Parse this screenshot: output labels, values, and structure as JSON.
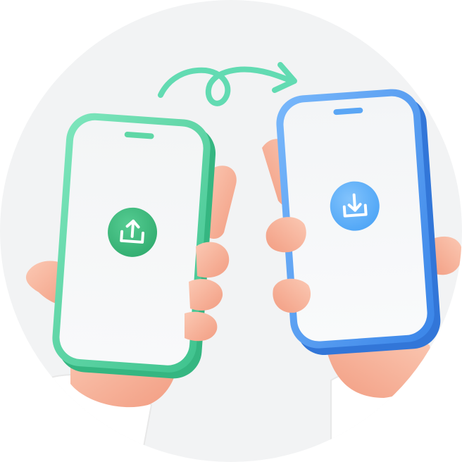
{
  "scene": {
    "description_free": true,
    "background_circle_color": "#f2f3f4",
    "transfer_arrow": {
      "icon": "curly-arrow-icon",
      "color": "#62dbb2"
    },
    "sender_phone": {
      "frame_color": "#5fd7a6",
      "screen_color": "#f5f7f8",
      "action_icon": "upload-icon",
      "action_color": "#3dbd7d"
    },
    "receiver_phone": {
      "frame_color": "#4d9bf3",
      "screen_color": "#f5f7f9",
      "action_icon": "download-icon",
      "action_color": "#5fb0fa"
    },
    "skin_color": "#f7b9a0",
    "sleeve_color": "#ffffff"
  }
}
